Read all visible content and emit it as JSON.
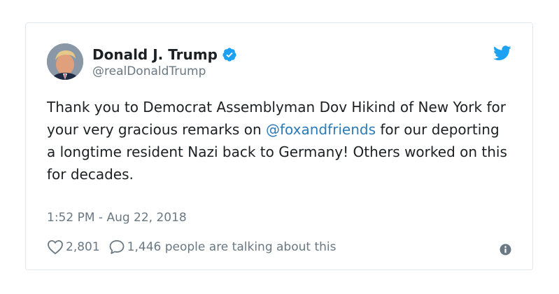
{
  "tweet": {
    "author_name": "Donald J. Trump",
    "handle": "@realDonaldTrump",
    "text_before": "Thank you to Democrat Assemblyman Dov Hikind of New York for your very gracious remarks on ",
    "mention": "@foxandfriends",
    "text_after": " for our deporting a longtime resident Nazi back to Germany! Others worked on this for decades.",
    "timestamp": "1:52 PM - Aug 22, 2018",
    "like_count": "2,801",
    "talking_text": "1,446 people are talking about this"
  },
  "colors": {
    "link": "#2b7bb9",
    "twitter_blue": "#1da1f2",
    "secondary_text": "#697882",
    "border": "#e1e8ed"
  },
  "icons": [
    "verified-badge-icon",
    "twitter-bird-icon",
    "heart-icon",
    "reply-bubble-icon",
    "info-icon"
  ]
}
